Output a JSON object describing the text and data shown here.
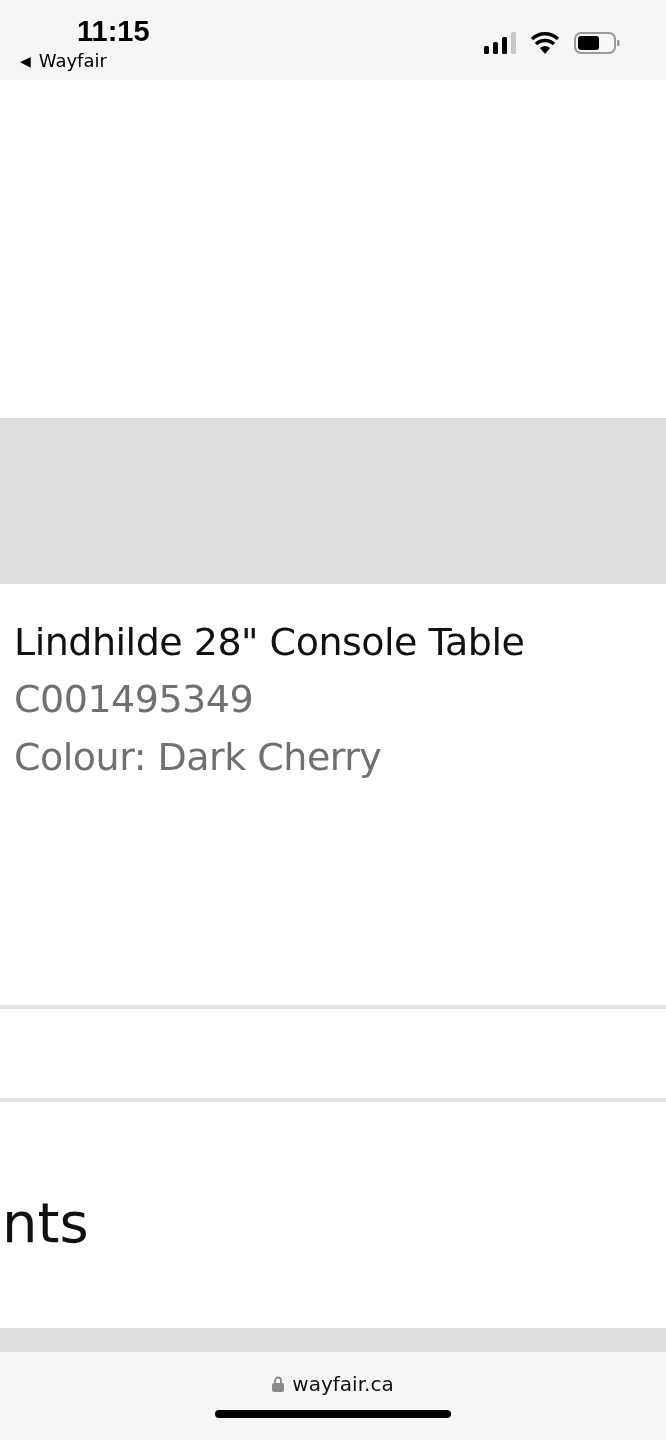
{
  "status_bar": {
    "time": "11:15",
    "back_arrow": "◀",
    "back_label": "Wayfair"
  },
  "product": {
    "title": "Lindhilde 28\" Console Table",
    "sku": "C001495349",
    "colour": "Colour: Dark Cherry"
  },
  "section_heading": "nts",
  "browser_bar": {
    "url": "wayfair.ca"
  }
}
